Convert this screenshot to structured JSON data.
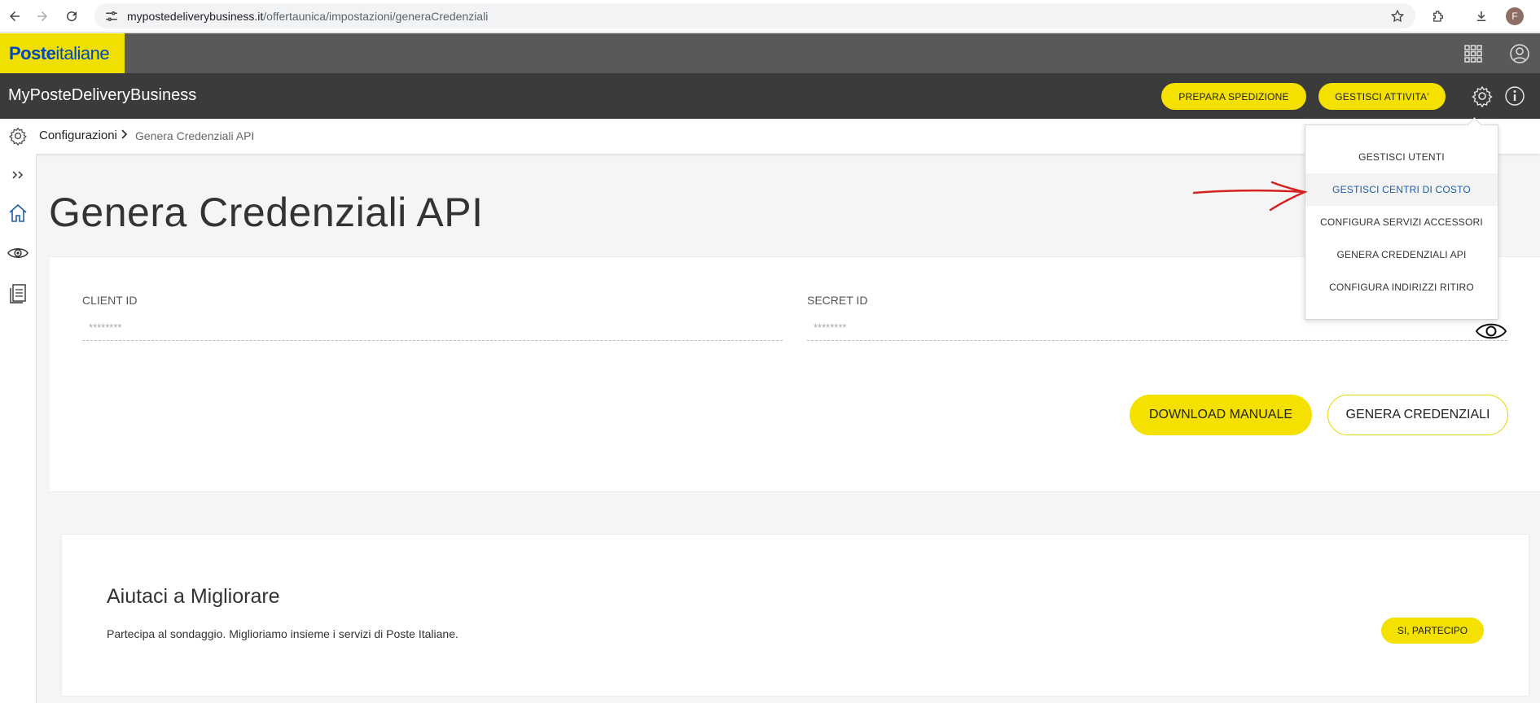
{
  "browser": {
    "url_domain": "mypostedeliverybusiness.it",
    "url_path": "/offertaunica/impostazioni/generaCredenziali",
    "avatar_letter": "F"
  },
  "brand": {
    "logo_bold": "Poste",
    "logo_regular": "italiane",
    "app_title": "MyPosteDeliveryBusiness"
  },
  "header": {
    "prepare_label": "PREPARA SPEDIZIONE",
    "manage_label": "GESTISCI ATTIVITA'"
  },
  "breadcrumb": {
    "root": "Configurazioni",
    "current": "Genera Credenziali API"
  },
  "main": {
    "title": "Genera Credenziali API",
    "client_label": "CLIENT ID",
    "client_value": "********",
    "secret_label": "SECRET ID",
    "secret_value": "********",
    "download_label": "DOWNLOAD MANUALE",
    "generate_label": "GENERA CREDENZIALI"
  },
  "survey": {
    "title": "Aiutaci a Migliorare",
    "text": "Partecipa al sondaggio. Miglioriamo insieme i servizi di Poste Italiane.",
    "button_label": "SI, PARTECIPO"
  },
  "dropdown": {
    "items": [
      {
        "label": "GESTISCI UTENTI"
      },
      {
        "label": "GESTISCI CENTRI DI COSTO"
      },
      {
        "label": "CONFIGURA SERVIZI ACCESSORI"
      },
      {
        "label": "GENERA CREDENZIALI API"
      },
      {
        "label": "CONFIGURA INDIRIZZI RITIRO"
      }
    ]
  },
  "colors": {
    "brand_yellow": "#f5e100",
    "logo_blue": "#0047bb",
    "top_bar": "#595959",
    "app_bar": "#3b3b3b",
    "annotation_arrow": "#d62020",
    "active_menu_text": "#1f5ea8"
  }
}
